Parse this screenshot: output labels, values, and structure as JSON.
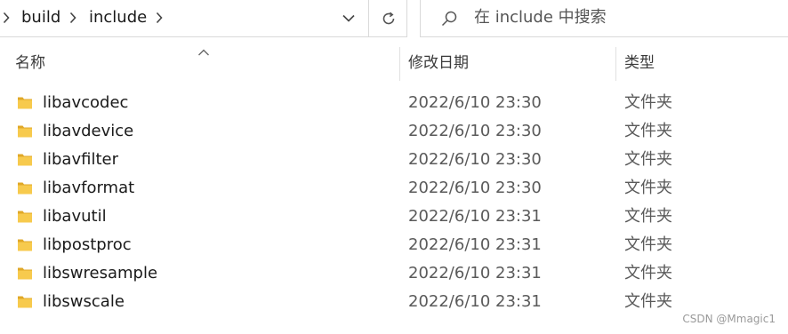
{
  "address": {
    "crumbs": [
      "build",
      "include"
    ]
  },
  "search": {
    "placeholder": "在 include 中搜索"
  },
  "columns": {
    "name": "名称",
    "date": "修改日期",
    "type": "类型"
  },
  "files": [
    {
      "name": "libavcodec",
      "date": "2022/6/10 23:30",
      "type": "文件夹"
    },
    {
      "name": "libavdevice",
      "date": "2022/6/10 23:30",
      "type": "文件夹"
    },
    {
      "name": "libavfilter",
      "date": "2022/6/10 23:30",
      "type": "文件夹"
    },
    {
      "name": "libavformat",
      "date": "2022/6/10 23:30",
      "type": "文件夹"
    },
    {
      "name": "libavutil",
      "date": "2022/6/10 23:31",
      "type": "文件夹"
    },
    {
      "name": "libpostproc",
      "date": "2022/6/10 23:31",
      "type": "文件夹"
    },
    {
      "name": "libswresample",
      "date": "2022/6/10 23:31",
      "type": "文件夹"
    },
    {
      "name": "libswscale",
      "date": "2022/6/10 23:31",
      "type": "文件夹"
    }
  ],
  "watermark": "CSDN @Mmagic1",
  "colors": {
    "folder": "#f5c542",
    "folder_dark": "#e0a828",
    "divider": "#d9d9d9"
  }
}
